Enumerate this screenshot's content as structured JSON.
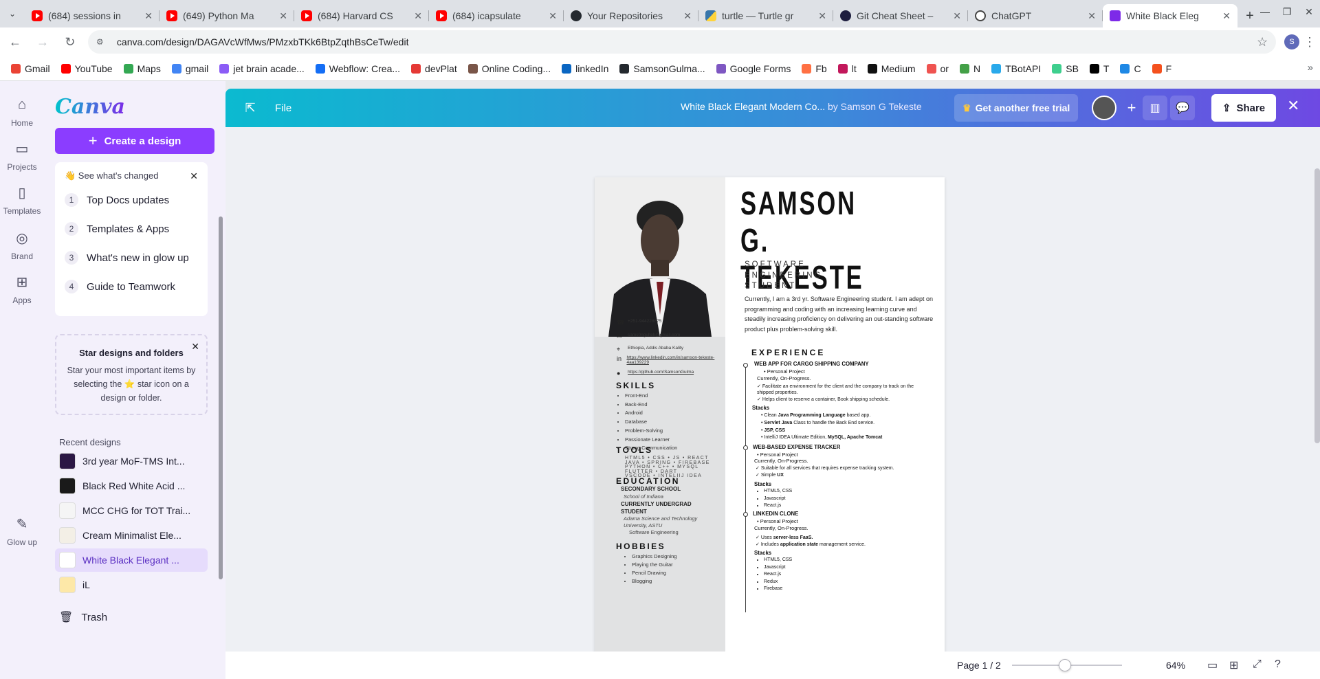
{
  "browser": {
    "tabs": [
      {
        "title": "(684) sessions in",
        "icon": "youtube"
      },
      {
        "title": "(649) Python Ma",
        "icon": "youtube"
      },
      {
        "title": "(684) Harvard CS",
        "icon": "youtube"
      },
      {
        "title": "(684) icapsulate",
        "icon": "youtube"
      },
      {
        "title": "Your Repositories",
        "icon": "github"
      },
      {
        "title": "turtle — Turtle gr",
        "icon": "python"
      },
      {
        "title": "Git Cheat Sheet –",
        "icon": "git"
      },
      {
        "title": "ChatGPT",
        "icon": "openai"
      },
      {
        "title": "White Black Eleg",
        "icon": "canva",
        "active": true
      }
    ],
    "url": "canva.com/design/DAGAVcWfMws/PMzxbTKk6BtpZqthBsCeTw/edit",
    "profile_initial": "S",
    "bookmarks": [
      {
        "label": "Gmail",
        "color": "#ea4335"
      },
      {
        "label": "YouTube",
        "color": "#ff0000"
      },
      {
        "label": "Maps",
        "color": "#34a853"
      },
      {
        "label": "gmail",
        "color": "#4285f4"
      },
      {
        "label": "jet brain acade...",
        "color": "#8b5cf6"
      },
      {
        "label": "Webflow: Crea...",
        "color": "#146ef5"
      },
      {
        "label": "devPlat",
        "color": "#e53935"
      },
      {
        "label": "Online Coding...",
        "color": "#795548"
      },
      {
        "label": "linkedIn",
        "color": "#0a66c2"
      },
      {
        "label": "SamsonGulma...",
        "color": "#24292f"
      },
      {
        "label": "Google Forms",
        "color": "#7e57c2"
      },
      {
        "label": "Fb",
        "color": "#ff7043"
      },
      {
        "label": "lt",
        "color": "#c2185b"
      },
      {
        "label": "Medium",
        "color": "#111111"
      },
      {
        "label": "or",
        "color": "#ef5350"
      },
      {
        "label": "N",
        "color": "#43a047"
      },
      {
        "label": "TBotAPI",
        "color": "#29a9eb"
      },
      {
        "label": "SB",
        "color": "#3ecf8e"
      },
      {
        "label": "T",
        "color": "#000000"
      },
      {
        "label": "C",
        "color": "#1e88e5"
      },
      {
        "label": "F",
        "color": "#f4511e"
      }
    ]
  },
  "canva": {
    "logo": "Canva",
    "rail": [
      {
        "label": "Home",
        "icon": "home-icon"
      },
      {
        "label": "Projects",
        "icon": "folder-icon"
      },
      {
        "label": "Templates",
        "icon": "templates-icon"
      },
      {
        "label": "Brand",
        "icon": "brand-icon"
      },
      {
        "label": "Apps",
        "icon": "apps-icon"
      },
      {
        "label": "Glow up",
        "icon": "glow-up-icon"
      }
    ],
    "create_label": "Create a design",
    "whats_changed": {
      "header": "👋 See what's changed",
      "items": [
        {
          "n": "1",
          "label": "Top Docs updates"
        },
        {
          "n": "2",
          "label": "Templates & Apps"
        },
        {
          "n": "3",
          "label": "What's new in glow up"
        },
        {
          "n": "4",
          "label": "Guide to Teamwork"
        }
      ]
    },
    "star_card": {
      "title": "Star designs and folders",
      "body": "Star your most important items by selecting the ⭐ star icon on a design or folder."
    },
    "recent_header": "Recent designs",
    "recent": [
      {
        "label": "3rd year MoF-TMS Int...",
        "thumb": "#2b1744"
      },
      {
        "label": "Black Red White Acid ...",
        "thumb": "#1a1a1a"
      },
      {
        "label": "MCC CHG for TOT Trai...",
        "thumb": "#f5f5f5"
      },
      {
        "label": "Cream Minimalist Ele...",
        "thumb": "#f3efe6"
      },
      {
        "label": "White Black Elegant ...",
        "thumb": "#ffffff",
        "selected": true
      },
      {
        "label": "iL",
        "thumb": "#fde8a8"
      }
    ],
    "trash_label": "Trash",
    "editor": {
      "file_label": "File",
      "doc_title": "White Black Elegant Modern Co...",
      "by": "by Samson G Tekeste",
      "trial_label": "Get another free trial",
      "share_label": "Share",
      "page_count": "Page 1 / 2",
      "zoom": "64%",
      "zoom_fraction": 0.48
    }
  },
  "resume": {
    "name_line1": "SAMSON G.",
    "name_line2": "TEKESTE",
    "subtitle": [
      "SOFTWARE",
      "ENGINEERING",
      "STUDENT"
    ],
    "summary": "Currently, I am a 3rd yr. Software Engineering student. I am adept on programming and coding with an increasing learning curve and steadily increasing proficiency on delivering an out-standing software product plus problem-solving skill.",
    "contacts": [
      {
        "icon": "phone-icon",
        "text": "+251-944228875"
      },
      {
        "icon": "mail-icon",
        "text": "sams0ngultek@gmail.com"
      },
      {
        "icon": "location-icon",
        "text": "Ethiopia, Addis Ababa Kality"
      },
      {
        "icon": "linkedin-icon",
        "text": "https://www.linkedin.com/in/samson-tekeste-4aa139229"
      },
      {
        "icon": "github-icon",
        "text": "https://github.com/SamsonGulma"
      }
    ],
    "skills_h": "SKILLS",
    "skills": [
      "Front-End",
      "Back-End",
      "Android",
      "Database",
      "Problem-Solving",
      "Passionate Learner",
      "Strong Communication"
    ],
    "tools_h": "TOOLS",
    "tools": [
      "HTML5 • CSS • JS • REACT",
      "JAVA • SPRING • FIREBASE",
      "PYTHON • C++ • MYSQL",
      "FLUTTER • DART",
      "VSCODE • INTELIIJ IDEA"
    ],
    "education_h": "EDUCATION",
    "edu1_title": "SECONDARY SCHOOL",
    "edu1_school": "School of Indiana",
    "edu2_title": "CURRENTLY UNDERGRAD STUDENT",
    "edu2_school": "Adama Science and Technology University, ASTU",
    "edu2_field": "Software Engineering",
    "hobbies_h": "HOBBIES",
    "hobbies": [
      "Graphics Designing",
      "Playing the Guitar",
      "Pencil Drawing",
      "Blogging"
    ],
    "experience_h": "EXPERIENCE",
    "exp1": {
      "title": "WEB APP FOR CARGO SHIPPING COMPANY",
      "type": "Personal Project",
      "status": "Currently, On-Progress.",
      "points": [
        "Facilitate an environment for the client and the company to track on the shipped properties.",
        "Helps client to reserve a container, Book shipping schedule."
      ],
      "stacks_h": "Stacks",
      "stacks": [
        {
          "pre": "Clean ",
          "bold": "Java Programming Language",
          "post": " based app."
        },
        {
          "pre": "",
          "bold": "Servlet Java",
          "post": " Class to handle the Back End service."
        },
        {
          "pre": "",
          "bold": "JSP, CSS",
          "post": ""
        },
        {
          "pre": "IntelliJ IDEA Ultimate Edition, ",
          "bold": "MySQL, Apache Tomcat",
          "post": ""
        }
      ]
    },
    "exp2": {
      "title": "WEB-BASED EXPENSE TRACKER",
      "type": "Personal Project",
      "status": "Currently, On-Progress.",
      "points": [
        {
          "pre": "Suitable for all services that requires expense tracking system.",
          "bold": ""
        },
        {
          "pre": "Simple ",
          "bold": "UX"
        }
      ],
      "stacks_h": "Stacks",
      "stacks": [
        "HTML5, CSS",
        "Javascript",
        "React.js"
      ]
    },
    "exp3": {
      "title": "LINKEDIN CLONE",
      "type": "Personal Project",
      "status": "Currently, On-Progress.",
      "points": [
        {
          "pre": "Uses ",
          "bold": "server-less FaaS."
        },
        {
          "pre": "Includes ",
          "bold": "application state",
          "post": " management service."
        }
      ],
      "stacks_h": "Stacks",
      "stacks": [
        "HTML5, CSS",
        "Javascript",
        "React.js",
        "Redux",
        "Firebase"
      ]
    }
  }
}
